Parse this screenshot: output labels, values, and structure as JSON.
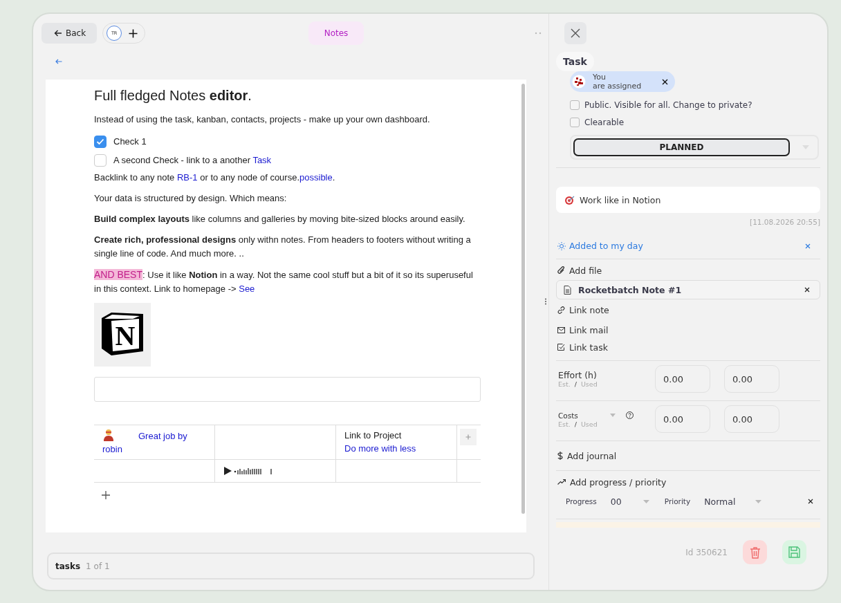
{
  "toolbar": {
    "back": "Back",
    "avatar": "TR",
    "tab": {
      "label": "Notes",
      "selected": true
    }
  },
  "editor": {
    "blocks": [
      {
        "kind": "heading",
        "text": "Full fledged Notes **editor**."
      },
      {
        "kind": "paragraph",
        "parts": [
          {
            "kind": "text",
            "text": "Instead of using the task, kanban, contacts, projects - make up your own dashboard."
          }
        ]
      },
      {
        "kind": "check",
        "checked": true,
        "parts": [
          {
            "kind": "text",
            "text": "Check 1"
          }
        ]
      },
      {
        "kind": "check",
        "checked": false,
        "parts": [
          {
            "kind": "text",
            "text": "A second Check - link to a another "
          },
          {
            "kind": "link",
            "text": "Task"
          }
        ]
      },
      {
        "kind": "paragraph",
        "parts": [
          {
            "kind": "text",
            "text": "Backlink to any note "
          },
          {
            "kind": "link",
            "text": "RB-1"
          },
          {
            "kind": "text",
            "text": " or to any node of course."
          },
          {
            "kind": "link",
            "text": "possible"
          },
          {
            "kind": "text",
            "text": "."
          }
        ]
      },
      {
        "kind": "paragraph",
        "parts": [
          {
            "kind": "text",
            "text": "Your data is structured by design. Which means:"
          }
        ]
      },
      {
        "kind": "paragraph",
        "parts": [
          {
            "kind": "text",
            "text": "**Build complex layouts** like columns and galleries by moving bite-sized blocks around easily."
          }
        ]
      },
      {
        "kind": "paragraph",
        "parts": [
          {
            "kind": "text",
            "text": "**Create rich, professional designs** only withn notes. From headers to footers without writing a single line of code. And much more. .."
          }
        ]
      },
      {
        "kind": "paragraph",
        "parts": [
          {
            "kind": "highlight",
            "text": "AND BEST"
          },
          {
            "kind": "text",
            "text": ": Use it like **Notion** in a way. Not the same cool stuff but a bit of it so its superuseful in this context. Link to homepage -> "
          },
          {
            "kind": "link",
            "text": "See"
          }
        ]
      },
      {
        "kind": "logo",
        "letter": "N"
      },
      {
        "kind": "input"
      },
      {
        "kind": "table",
        "rows": [
          [
            {
              "kind": "person",
              "text": "Great job by robin"
            },
            {
              "kind": "empty"
            },
            {
              "kind": "text",
              "parts": [
                {
                  "kind": "text",
                  "text": "Link to Project "
                },
                {
                  "kind": "link",
                  "text": "Do more with less"
                }
              ]
            },
            {
              "kind": "add"
            }
          ],
          [
            {
              "kind": "empty"
            },
            {
              "kind": "audio"
            },
            {
              "kind": "empty"
            },
            {
              "kind": "empty"
            }
          ]
        ]
      }
    ]
  },
  "footer": {
    "label": "tasks",
    "count": "1 of 1"
  },
  "task": {
    "title": "Task",
    "assignee": {
      "name": "You",
      "note": "are assigned"
    },
    "options": [
      {
        "label": "Public.  Visible for all. Change to private?",
        "checked": false
      },
      {
        "label": "Clearable",
        "checked": false
      }
    ],
    "status": "PLANNED",
    "name": "Work like in Notion",
    "timestamp": "[11.08.2026 20:55]",
    "my_day": "Added to my day",
    "add_file": "Add file",
    "attachment": "Rocketbatch Note #1",
    "links": [
      {
        "kind": "note",
        "label": "Link note"
      },
      {
        "kind": "mail",
        "label": "Link mail"
      },
      {
        "kind": "task",
        "label": "Link task"
      }
    ],
    "measures": [
      {
        "kind": "effort",
        "label": "Effort (h)",
        "est": "Est.",
        "sep": "/",
        "used": "Used",
        "values": [
          "0.00",
          "0.00"
        ]
      },
      {
        "kind": "costs",
        "label": "Costs",
        "est": "Est.",
        "sep": "/",
        "used": "Used",
        "values": [
          "0.00",
          "0.00"
        ]
      }
    ],
    "journal": "Add journal",
    "progress_title": "Add progress / priority",
    "progress": {
      "label": "Progress",
      "value": "00"
    },
    "priority": {
      "label": "Priority",
      "value": "Normal"
    },
    "id": "Id 350621"
  }
}
